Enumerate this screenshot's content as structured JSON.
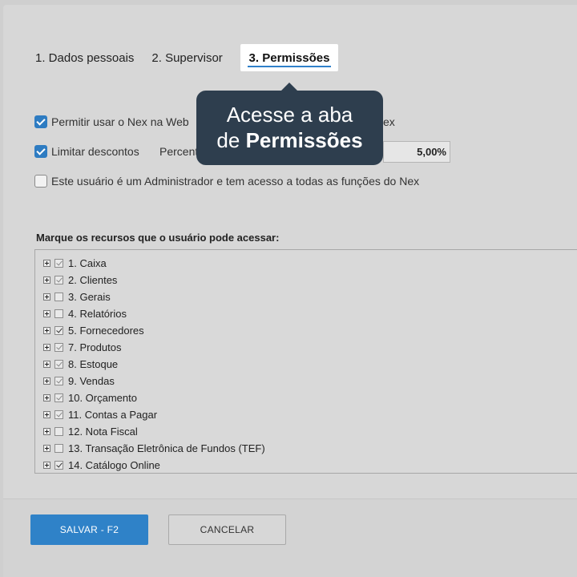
{
  "tabs": [
    {
      "label": "1. Dados pessoais"
    },
    {
      "label": "2. Supervisor"
    },
    {
      "label": "3. Permissões",
      "active": true
    }
  ],
  "tooltip": {
    "line1": "Acesse a aba",
    "line2_prefix": "de ",
    "line2_bold": "Permissões"
  },
  "options": {
    "web": {
      "label": "Permitir usar o Nex na Web",
      "checked": true,
      "suffix": "ex"
    },
    "discount": {
      "label": "Limitar descontos",
      "checked": true,
      "pct_label": "Percent",
      "pct_value": "5,00%"
    },
    "admin": {
      "label": "Este usuário é um Administrador e tem acesso a todas as funções do Nex",
      "checked": false
    }
  },
  "resources": {
    "label": "Marque os recursos que o usuário pode acessar:",
    "items": [
      {
        "label": "1. Caixa",
        "state": "partial"
      },
      {
        "label": "2. Clientes",
        "state": "partial"
      },
      {
        "label": "3. Gerais",
        "state": "unchecked"
      },
      {
        "label": "4. Relatórios",
        "state": "unchecked"
      },
      {
        "label": "5. Fornecedores",
        "state": "checked"
      },
      {
        "label": "7. Produtos",
        "state": "partial"
      },
      {
        "label": "8. Estoque",
        "state": "partial"
      },
      {
        "label": "9. Vendas",
        "state": "partial"
      },
      {
        "label": "10. Orçamento",
        "state": "partial"
      },
      {
        "label": "11. Contas a Pagar",
        "state": "partial"
      },
      {
        "label": "12. Nota Fiscal",
        "state": "unchecked"
      },
      {
        "label": "13. Transação Eletrônica de Fundos (TEF)",
        "state": "unchecked"
      },
      {
        "label": "14. Catálogo Online",
        "state": "checked"
      }
    ]
  },
  "footer": {
    "save_label": "SALVAR - F2",
    "cancel_label": "CANCELAR"
  },
  "colors": {
    "accent": "#2f82c8",
    "tooltip_bg": "#2e3e4e"
  }
}
